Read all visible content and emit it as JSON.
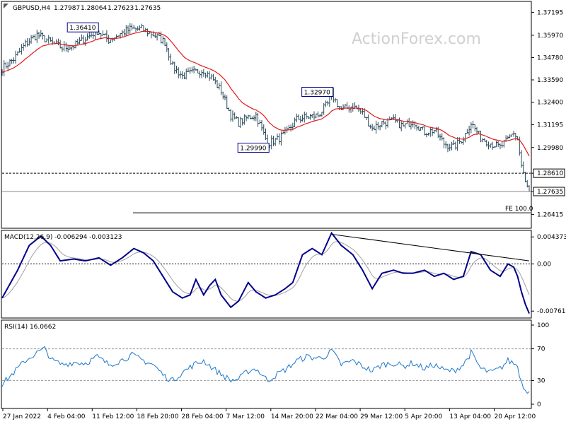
{
  "chart_data": {
    "type": "candlestick",
    "watermark": "ActionForex.com",
    "header": {
      "symbol": "GBPUSD,H4",
      "open": "1.27987",
      "high": "1.28064",
      "low": "1.27623",
      "close": "1.27635"
    },
    "x_labels": [
      "27 Jan 2022",
      "4 Feb 04:00",
      "11 Feb 12:00",
      "18 Feb 20:00",
      "28 Feb 04:00",
      "7 Mar 12:00",
      "14 Mar 20:00",
      "22 Mar 04:00",
      "29 Mar 12:00",
      "5 Apr 20:00",
      "13 Apr 04:00",
      "20 Apr 12:00"
    ],
    "price_panel": {
      "ylim": [
        1.2575,
        1.377
      ],
      "y_ticks": [
        "1.37195",
        "1.35970",
        "1.34780",
        "1.33590",
        "1.32400",
        "1.31195",
        "1.29980",
        "1.28610",
        "1.27635",
        "1.26415"
      ],
      "current_price": 1.27635,
      "current_label": "1.27635",
      "hline": {
        "value": 1.2861,
        "label": "1.28610"
      },
      "fe_line": {
        "value": 1.265,
        "label": "FE 100.0"
      },
      "ma_color": "#e01a1a",
      "bar_color": "#2a4a5a",
      "annotations": [
        {
          "label": "1.36410",
          "index": 49,
          "value": 1.3641
        },
        {
          "label": "1.29990",
          "index": 137,
          "value": 1.2999
        },
        {
          "label": "1.32970",
          "index": 170,
          "value": 1.3297
        }
      ],
      "anchors": [
        [
          0,
          1.342
        ],
        [
          6,
          1.347
        ],
        [
          12,
          1.355
        ],
        [
          18,
          1.36
        ],
        [
          25,
          1.356
        ],
        [
          31,
          1.353
        ],
        [
          37,
          1.354
        ],
        [
          43,
          1.358
        ],
        [
          49,
          1.362
        ],
        [
          55,
          1.357
        ],
        [
          60,
          1.36
        ],
        [
          66,
          1.363
        ],
        [
          72,
          1.363
        ],
        [
          78,
          1.36
        ],
        [
          84,
          1.356
        ],
        [
          88,
          1.343
        ],
        [
          93,
          1.338
        ],
        [
          99,
          1.34
        ],
        [
          104,
          1.341
        ],
        [
          109,
          1.336
        ],
        [
          113,
          1.33
        ],
        [
          118,
          1.317
        ],
        [
          122,
          1.313
        ],
        [
          127,
          1.316
        ],
        [
          131,
          1.317
        ],
        [
          137,
          1.302
        ],
        [
          142,
          1.304
        ],
        [
          147,
          1.308
        ],
        [
          152,
          1.315
        ],
        [
          157,
          1.316
        ],
        [
          163,
          1.317
        ],
        [
          168,
          1.323
        ],
        [
          170,
          1.328
        ],
        [
          175,
          1.32
        ],
        [
          181,
          1.322
        ],
        [
          186,
          1.318
        ],
        [
          191,
          1.31
        ],
        [
          196,
          1.313
        ],
        [
          202,
          1.314
        ],
        [
          207,
          1.311
        ],
        [
          212,
          1.314
        ],
        [
          218,
          1.308
        ],
        [
          223,
          1.309
        ],
        [
          228,
          1.302
        ],
        [
          233,
          1.3
        ],
        [
          238,
          1.305
        ],
        [
          242,
          1.313
        ],
        [
          247,
          1.305
        ],
        [
          252,
          1.302
        ],
        [
          257,
          1.3
        ],
        [
          261,
          1.304
        ],
        [
          264,
          1.308
        ],
        [
          266,
          1.304
        ],
        [
          268,
          1.29
        ],
        [
          270,
          1.281
        ],
        [
          272,
          1.2764
        ]
      ]
    },
    "macd_panel": {
      "label": "MACD(12,26,9) -0.006294 -0.003123",
      "ylim": [
        -0.0085,
        0.0052
      ],
      "y_ticks": [
        "0.004373",
        "0.00",
        "-0.007613"
      ],
      "main_color": "#00008b",
      "signal_color": "#a0a0a0",
      "trendline_color": "#000000",
      "anchors": [
        [
          0,
          -0.0055
        ],
        [
          8,
          -0.001
        ],
        [
          14,
          0.003
        ],
        [
          20,
          0.0045
        ],
        [
          25,
          0.003
        ],
        [
          30,
          0.0005
        ],
        [
          37,
          0.0008
        ],
        [
          43,
          0.0005
        ],
        [
          50,
          0.001
        ],
        [
          56,
          -0.0002
        ],
        [
          62,
          0.001
        ],
        [
          68,
          0.0025
        ],
        [
          73,
          0.0018
        ],
        [
          78,
          0.0005
        ],
        [
          83,
          -0.002
        ],
        [
          88,
          -0.0045
        ],
        [
          93,
          -0.0055
        ],
        [
          97,
          -0.005
        ],
        [
          100,
          -0.0025
        ],
        [
          104,
          -0.005
        ],
        [
          107,
          -0.0035
        ],
        [
          110,
          -0.0025
        ],
        [
          113,
          -0.005
        ],
        [
          118,
          -0.007
        ],
        [
          122,
          -0.006
        ],
        [
          127,
          -0.003
        ],
        [
          131,
          -0.0045
        ],
        [
          136,
          -0.0055
        ],
        [
          141,
          -0.005
        ],
        [
          146,
          -0.004
        ],
        [
          150,
          -0.003
        ],
        [
          155,
          0.0015
        ],
        [
          160,
          0.0025
        ],
        [
          165,
          0.0015
        ],
        [
          170,
          0.005
        ],
        [
          175,
          0.003
        ],
        [
          181,
          0.0015
        ],
        [
          186,
          -0.001
        ],
        [
          191,
          -0.004
        ],
        [
          196,
          -0.0015
        ],
        [
          202,
          -0.001
        ],
        [
          207,
          -0.0015
        ],
        [
          212,
          -0.0015
        ],
        [
          218,
          -0.001
        ],
        [
          223,
          -0.002
        ],
        [
          228,
          -0.0015
        ],
        [
          233,
          -0.0025
        ],
        [
          238,
          -0.002
        ],
        [
          242,
          0.002
        ],
        [
          247,
          0.0015
        ],
        [
          252,
          -0.001
        ],
        [
          257,
          -0.002
        ],
        [
          261,
          0.0
        ],
        [
          264,
          -0.0005
        ],
        [
          266,
          -0.002
        ],
        [
          268,
          -0.0045
        ],
        [
          270,
          -0.0065
        ],
        [
          272,
          -0.008
        ]
      ],
      "trendline": [
        [
          170,
          0.0048
        ],
        [
          272,
          0.0005
        ]
      ]
    },
    "rsi_panel": {
      "label": "RSI(14) 16.0662",
      "ylim": [
        0,
        100
      ],
      "y_ticks": [
        "100",
        "70",
        "30",
        "0"
      ],
      "levels": [
        70,
        30
      ],
      "color": "#1e78c8",
      "anchors": [
        [
          0,
          25
        ],
        [
          6,
          40
        ],
        [
          12,
          55
        ],
        [
          18,
          65
        ],
        [
          22,
          70
        ],
        [
          26,
          55
        ],
        [
          31,
          50
        ],
        [
          37,
          53
        ],
        [
          43,
          52
        ],
        [
          49,
          60
        ],
        [
          55,
          50
        ],
        [
          61,
          55
        ],
        [
          67,
          62
        ],
        [
          73,
          55
        ],
        [
          78,
          50
        ],
        [
          84,
          35
        ],
        [
          88,
          30
        ],
        [
          93,
          40
        ],
        [
          99,
          50
        ],
        [
          104,
          55
        ],
        [
          109,
          45
        ],
        [
          113,
          38
        ],
        [
          118,
          30
        ],
        [
          122,
          32
        ],
        [
          127,
          42
        ],
        [
          131,
          45
        ],
        [
          137,
          30
        ],
        [
          142,
          38
        ],
        [
          147,
          45
        ],
        [
          152,
          55
        ],
        [
          157,
          60
        ],
        [
          163,
          58
        ],
        [
          168,
          62
        ],
        [
          170,
          68
        ],
        [
          175,
          50
        ],
        [
          181,
          55
        ],
        [
          186,
          48
        ],
        [
          191,
          42
        ],
        [
          196,
          50
        ],
        [
          202,
          52
        ],
        [
          207,
          48
        ],
        [
          212,
          52
        ],
        [
          218,
          45
        ],
        [
          223,
          50
        ],
        [
          228,
          43
        ],
        [
          233,
          42
        ],
        [
          238,
          50
        ],
        [
          242,
          65
        ],
        [
          247,
          45
        ],
        [
          252,
          40
        ],
        [
          257,
          45
        ],
        [
          261,
          55
        ],
        [
          264,
          52
        ],
        [
          266,
          48
        ],
        [
          268,
          28
        ],
        [
          270,
          18
        ],
        [
          272,
          16
        ]
      ]
    }
  }
}
